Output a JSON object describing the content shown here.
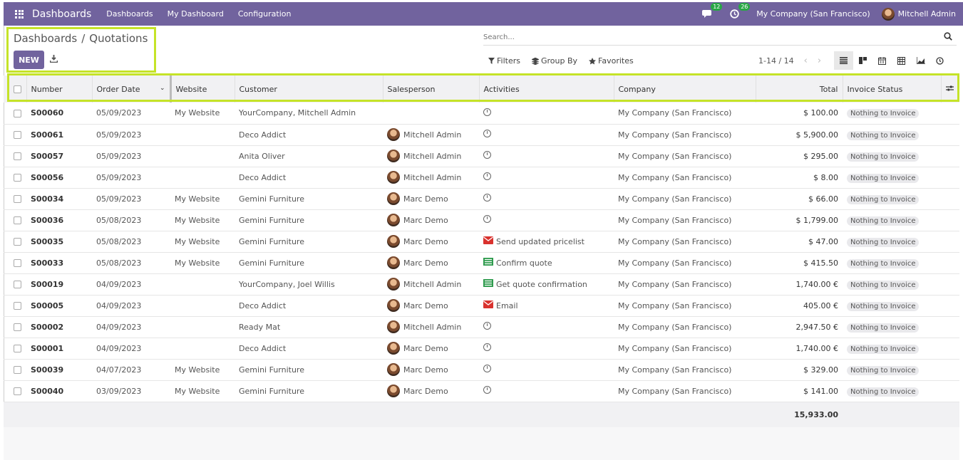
{
  "navbar": {
    "brand": "Dashboards",
    "menus": [
      "Dashboards",
      "My Dashboard",
      "Configuration"
    ],
    "messages_count": "12",
    "activities_count": "26",
    "company": "My Company (San Francisco)",
    "user": "Mitchell Admin",
    "color": "#71639e"
  },
  "breadcrumb": {
    "parent": "Dashboards",
    "separator": "/",
    "current": "Quotations"
  },
  "buttons": {
    "new": "NEW"
  },
  "search": {
    "placeholder": "Search..."
  },
  "filters": {
    "filters": "Filters",
    "group_by": "Group By",
    "favorites": "Favorites"
  },
  "pager": {
    "range": "1-14 / 14"
  },
  "columns": {
    "number": "Number",
    "order_date": "Order Date",
    "website": "Website",
    "customer": "Customer",
    "salesperson": "Salesperson",
    "activities": "Activities",
    "company": "Company",
    "total": "Total",
    "invoice_status": "Invoice Status"
  },
  "rows": [
    {
      "number": "S00060",
      "date": "05/09/2023",
      "website": "My Website",
      "customer": "YourCompany, Mitchell Admin",
      "salesperson": "",
      "activity": "",
      "activity_icon": "clock-icon",
      "company": "My Company (San Francisco)",
      "total": "$ 100.00",
      "status": "Nothing to Invoice"
    },
    {
      "number": "S00061",
      "date": "05/09/2023",
      "website": "",
      "customer": "Deco Addict",
      "salesperson": "Mitchell Admin",
      "activity": "",
      "activity_icon": "clock-icon",
      "company": "My Company (San Francisco)",
      "total": "$ 5,900.00",
      "status": "Nothing to Invoice"
    },
    {
      "number": "S00057",
      "date": "05/09/2023",
      "website": "",
      "customer": "Anita Oliver",
      "salesperson": "Mitchell Admin",
      "activity": "",
      "activity_icon": "clock-icon",
      "company": "My Company (San Francisco)",
      "total": "$ 295.00",
      "status": "Nothing to Invoice"
    },
    {
      "number": "S00056",
      "date": "05/09/2023",
      "website": "",
      "customer": "Deco Addict",
      "salesperson": "Mitchell Admin",
      "activity": "",
      "activity_icon": "clock-icon",
      "company": "My Company (San Francisco)",
      "total": "$ 8.00",
      "status": "Nothing to Invoice"
    },
    {
      "number": "S00034",
      "date": "05/09/2023",
      "website": "My Website",
      "customer": "Gemini Furniture",
      "salesperson": "Marc Demo",
      "activity": "",
      "activity_icon": "clock-icon",
      "company": "My Company (San Francisco)",
      "total": "$ 66.00",
      "status": "Nothing to Invoice"
    },
    {
      "number": "S00036",
      "date": "05/08/2023",
      "website": "My Website",
      "customer": "Gemini Furniture",
      "salesperson": "Marc Demo",
      "activity": "",
      "activity_icon": "clock-icon",
      "company": "My Company (San Francisco)",
      "total": "$ 1,799.00",
      "status": "Nothing to Invoice"
    },
    {
      "number": "S00035",
      "date": "05/08/2023",
      "website": "My Website",
      "customer": "Gemini Furniture",
      "salesperson": "Marc Demo",
      "activity": "Send updated pricelist",
      "activity_icon": "email-icon",
      "company": "My Company (San Francisco)",
      "total": "$ 47.00",
      "status": "Nothing to Invoice"
    },
    {
      "number": "S00033",
      "date": "05/08/2023",
      "website": "My Website",
      "customer": "Gemini Furniture",
      "salesperson": "Marc Demo",
      "activity": "Confirm quote",
      "activity_icon": "todo-icon",
      "company": "My Company (San Francisco)",
      "total": "$ 415.50",
      "status": "Nothing to Invoice"
    },
    {
      "number": "S00019",
      "date": "04/09/2023",
      "website": "",
      "customer": "YourCompany, Joel Willis",
      "salesperson": "Mitchell Admin",
      "activity": "Get quote confirmation",
      "activity_icon": "todo-icon",
      "company": "My Company (San Francisco)",
      "total": "1,740.00 €",
      "status": "Nothing to Invoice"
    },
    {
      "number": "S00005",
      "date": "04/09/2023",
      "website": "",
      "customer": "Deco Addict",
      "salesperson": "Marc Demo",
      "activity": "Email",
      "activity_icon": "email-icon",
      "company": "My Company (San Francisco)",
      "total": "405.00 €",
      "status": "Nothing to Invoice"
    },
    {
      "number": "S00002",
      "date": "04/09/2023",
      "website": "",
      "customer": "Ready Mat",
      "salesperson": "Mitchell Admin",
      "activity": "",
      "activity_icon": "clock-icon",
      "company": "My Company (San Francisco)",
      "total": "2,947.50 €",
      "status": "Nothing to Invoice"
    },
    {
      "number": "S00001",
      "date": "04/09/2023",
      "website": "",
      "customer": "Deco Addict",
      "salesperson": "Marc Demo",
      "activity": "",
      "activity_icon": "clock-icon",
      "company": "My Company (San Francisco)",
      "total": "1,740.00 €",
      "status": "Nothing to Invoice"
    },
    {
      "number": "S00039",
      "date": "04/07/2023",
      "website": "My Website",
      "customer": "Gemini Furniture",
      "salesperson": "Marc Demo",
      "activity": "",
      "activity_icon": "clock-icon",
      "company": "My Company (San Francisco)",
      "total": "$ 329.00",
      "status": "Nothing to Invoice"
    },
    {
      "number": "S00040",
      "date": "03/09/2023",
      "website": "My Website",
      "customer": "Gemini Furniture",
      "salesperson": "Marc Demo",
      "activity": "",
      "activity_icon": "clock-icon",
      "company": "My Company (San Francisco)",
      "total": "$ 141.00",
      "status": "Nothing to Invoice"
    }
  ],
  "footer": {
    "sum_total": "15,933.00"
  },
  "highlight_color": "#c5e328"
}
